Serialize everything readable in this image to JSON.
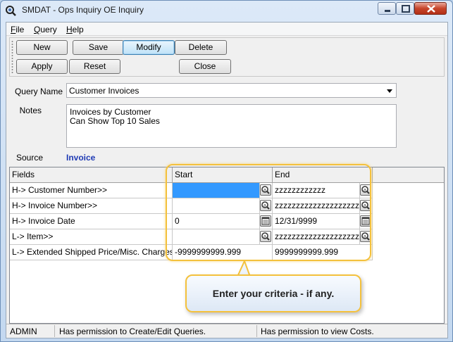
{
  "window": {
    "title": "SMDAT  - Ops Inquiry OE Inquiry"
  },
  "menu": [
    {
      "label": "File",
      "mnemonic": "F",
      "rest": "ile"
    },
    {
      "label": "Query",
      "mnemonic": "Q",
      "rest": "uery"
    },
    {
      "label": "Help",
      "mnemonic": "H",
      "rest": "elp"
    }
  ],
  "toolbar": {
    "new": "New",
    "save": "Save",
    "modify": "Modify",
    "delete": "Delete",
    "apply": "Apply",
    "reset": "Reset",
    "close": "Close"
  },
  "form": {
    "query_name_label": "Query Name",
    "query_name_value": "Customer Invoices",
    "notes_label": "Notes",
    "notes_value": "Invoices by Customer\nCan Show Top 10 Sales",
    "source_label": "Source",
    "source_value": "Invoice"
  },
  "grid": {
    "headers": {
      "fields": "Fields",
      "start": "Start",
      "end": "End"
    },
    "rows": [
      {
        "field": "H-> Customer Number>>",
        "start": "",
        "end": "zzzzzzzzzzzz",
        "icon": "lookup"
      },
      {
        "field": "H-> Invoice Number>>",
        "start": "",
        "end": "zzzzzzzzzzzzzzzzzzzzzz",
        "icon": "lookup"
      },
      {
        "field": "H-> Invoice Date",
        "start": "0",
        "end": "12/31/9999",
        "icon": "calendar"
      },
      {
        "field": "L-> Item>>",
        "start": "",
        "end": "zzzzzzzzzzzzzzzzzzzzzzzz",
        "icon": "lookup"
      },
      {
        "field": "L-> Extended Shipped Price/Misc. Charges*",
        "start": "-9999999999.999",
        "end": "9999999999.999",
        "icon": ""
      }
    ]
  },
  "callout": {
    "text": "Enter your criteria - if any."
  },
  "status": {
    "user": "ADMIN",
    "perm_queries": "Has permission to Create/Edit Queries.",
    "perm_costs": "Has permission to view Costs."
  }
}
